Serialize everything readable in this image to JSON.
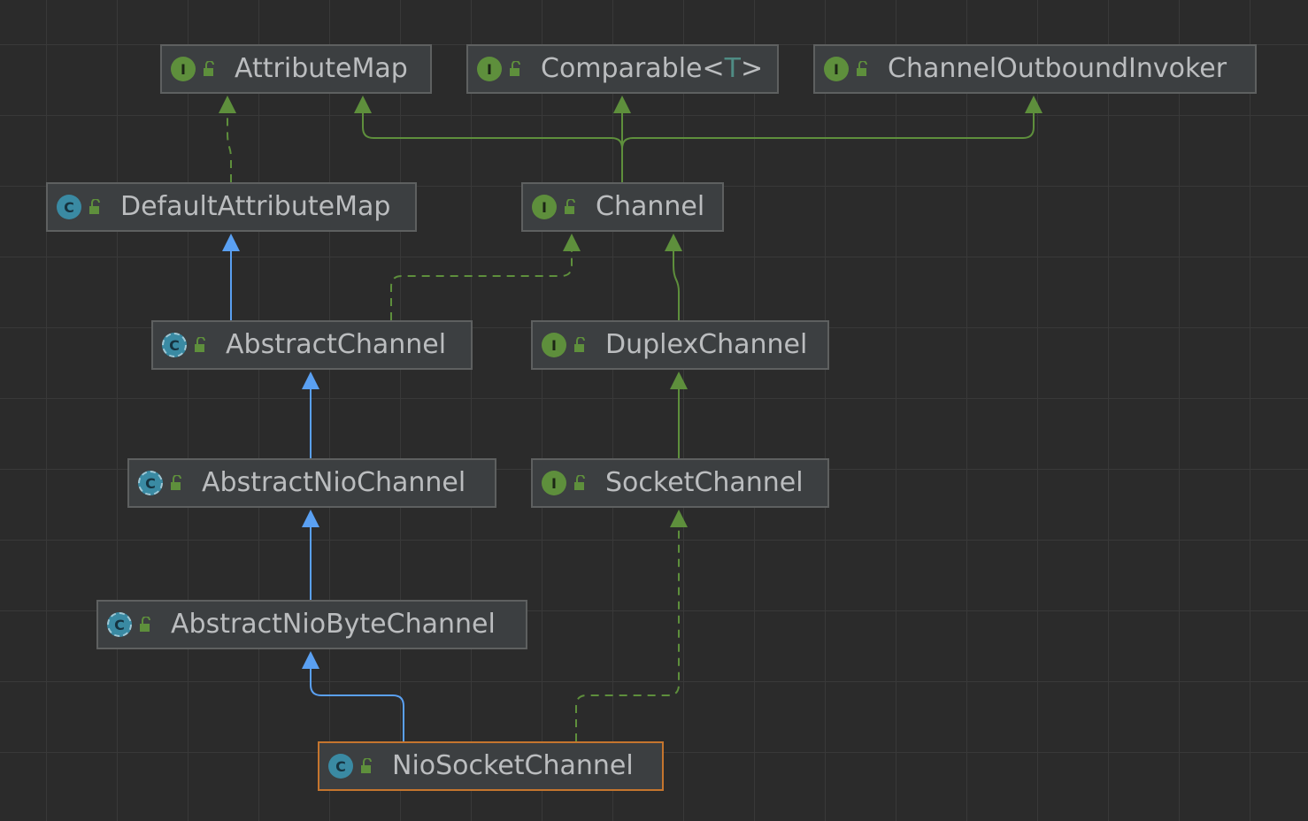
{
  "nodes": {
    "attributemap": {
      "label": "AttributeMap",
      "kind": "interface",
      "kind_letter": "I"
    },
    "comparable": {
      "label": "Comparable<",
      "type_param": "T",
      "label_suffix": ">",
      "kind": "interface",
      "kind_letter": "I"
    },
    "channeloutboundinvoker": {
      "label": "ChannelOutboundInvoker",
      "kind": "interface",
      "kind_letter": "I"
    },
    "defaultattributemap": {
      "label": "DefaultAttributeMap",
      "kind": "class",
      "kind_letter": "C"
    },
    "channel": {
      "label": "Channel",
      "kind": "interface",
      "kind_letter": "I"
    },
    "abstractchannel": {
      "label": "AbstractChannel",
      "kind": "abstract-class",
      "kind_letter": "C"
    },
    "duplexchannel": {
      "label": "DuplexChannel",
      "kind": "interface",
      "kind_letter": "I"
    },
    "abstractniochannel": {
      "label": "AbstractNioChannel",
      "kind": "abstract-class",
      "kind_letter": "C"
    },
    "socketchannel": {
      "label": "SocketChannel",
      "kind": "interface",
      "kind_letter": "I"
    },
    "abstractniobytechannel": {
      "label": "AbstractNioByteChannel",
      "kind": "abstract-class",
      "kind_letter": "C"
    },
    "niosocketchannel": {
      "label": "NioSocketChannel",
      "kind": "class",
      "kind_letter": "C",
      "selected": true
    }
  },
  "edges": [
    {
      "from": "defaultattributemap",
      "to": "attributemap",
      "type": "implements"
    },
    {
      "from": "channel",
      "to": "attributemap",
      "type": "extends-interface"
    },
    {
      "from": "channel",
      "to": "comparable",
      "type": "extends-interface"
    },
    {
      "from": "channel",
      "to": "channeloutboundinvoker",
      "type": "extends-interface"
    },
    {
      "from": "abstractchannel",
      "to": "defaultattributemap",
      "type": "extends-class"
    },
    {
      "from": "abstractchannel",
      "to": "channel",
      "type": "implements"
    },
    {
      "from": "duplexchannel",
      "to": "channel",
      "type": "extends-interface"
    },
    {
      "from": "abstractniochannel",
      "to": "abstractchannel",
      "type": "extends-class"
    },
    {
      "from": "socketchannel",
      "to": "duplexchannel",
      "type": "extends-interface"
    },
    {
      "from": "abstractniobytechannel",
      "to": "abstractniochannel",
      "type": "extends-class"
    },
    {
      "from": "niosocketchannel",
      "to": "abstractniobytechannel",
      "type": "extends-class"
    },
    {
      "from": "niosocketchannel",
      "to": "socketchannel",
      "type": "implements"
    }
  ],
  "colors": {
    "background": "#2b2b2b",
    "extends_class": "#5aa0f2",
    "interface_edge": "#5e8f3c",
    "selected_border": "#c5752e"
  }
}
